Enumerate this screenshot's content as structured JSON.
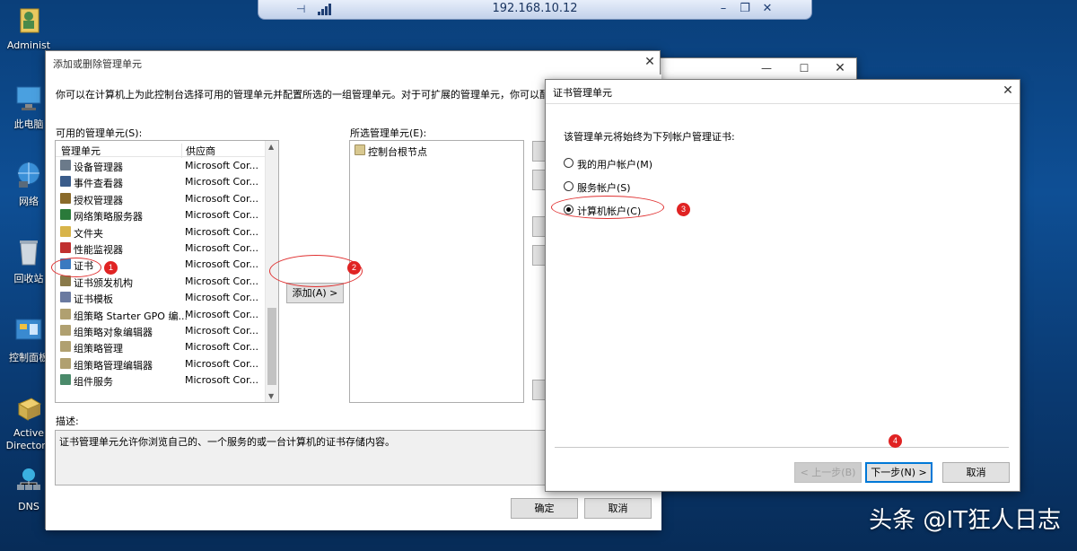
{
  "rdp": {
    "host": "192.168.10.12"
  },
  "desktop": {
    "icons": [
      {
        "label": "Administ"
      },
      {
        "label": "此电脑"
      },
      {
        "label": "网络"
      },
      {
        "label": "回收站"
      },
      {
        "label": "控制面板"
      },
      {
        "label": "Active\nDirectory"
      },
      {
        "label": "DNS"
      }
    ]
  },
  "add_remove": {
    "title": "添加或删除管理单元",
    "intro": "你可以在计算机上为此控制台选择可用的管理单元并配置所选的一组管理单元。对于可扩展的管理单元，你可以配置要",
    "available_label": "可用的管理单元(S):",
    "col_snapin": "管理单元",
    "col_vendor": "供应商",
    "snapins": [
      {
        "name": "设备管理器",
        "vendor": "Microsoft Cor...",
        "color": "#6b7a8a"
      },
      {
        "name": "事件查看器",
        "vendor": "Microsoft Cor...",
        "color": "#3a5c8a"
      },
      {
        "name": "授权管理器",
        "vendor": "Microsoft Cor...",
        "color": "#8a6a2a"
      },
      {
        "name": "网络策略服务器",
        "vendor": "Microsoft Cor...",
        "color": "#2a7a3a"
      },
      {
        "name": "文件夹",
        "vendor": "Microsoft Cor...",
        "color": "#d8b44a"
      },
      {
        "name": "性能监视器",
        "vendor": "Microsoft Cor...",
        "color": "#c03030"
      },
      {
        "name": "证书",
        "vendor": "Microsoft Cor...",
        "color": "#3a7ac0"
      },
      {
        "name": "证书颁发机构",
        "vendor": "Microsoft Cor...",
        "color": "#8a7a4a"
      },
      {
        "name": "证书模板",
        "vendor": "Microsoft Cor...",
        "color": "#6a7aa0"
      },
      {
        "name": "组策略 Starter GPO 编...",
        "vendor": "Microsoft Cor...",
        "color": "#b0a070"
      },
      {
        "name": "组策略对象编辑器",
        "vendor": "Microsoft Cor...",
        "color": "#b0a070"
      },
      {
        "name": "组策略管理",
        "vendor": "Microsoft Cor...",
        "color": "#b0a070"
      },
      {
        "name": "组策略管理编辑器",
        "vendor": "Microsoft Cor...",
        "color": "#b0a070"
      },
      {
        "name": "组件服务",
        "vendor": "Microsoft Cor...",
        "color": "#4a8a6a"
      }
    ],
    "add_button": "添加(A) >",
    "selected_label": "所选管理单元(E):",
    "selected_items": [
      "控制台根节点"
    ],
    "description_label": "描述:",
    "description": "证书管理单元允许你浏览自己的、一个服务的或一台计算机的证书存储内容。",
    "ok": "确定",
    "cancel": "取消"
  },
  "cert_dialog": {
    "title": "证书管理单元",
    "prompt": "该管理单元将始终为下列帐户管理证书:",
    "options": [
      {
        "label": "我的用户帐户(M)",
        "checked": false
      },
      {
        "label": "服务帐户(S)",
        "checked": false
      },
      {
        "label": "计算机帐户(C)",
        "checked": true
      }
    ],
    "back": "< 上一步(B)",
    "next": "下一步(N) >",
    "cancel": "取消"
  },
  "annotations": [
    "1",
    "2",
    "3",
    "4"
  ],
  "watermark": "头条 @IT狂人日志"
}
